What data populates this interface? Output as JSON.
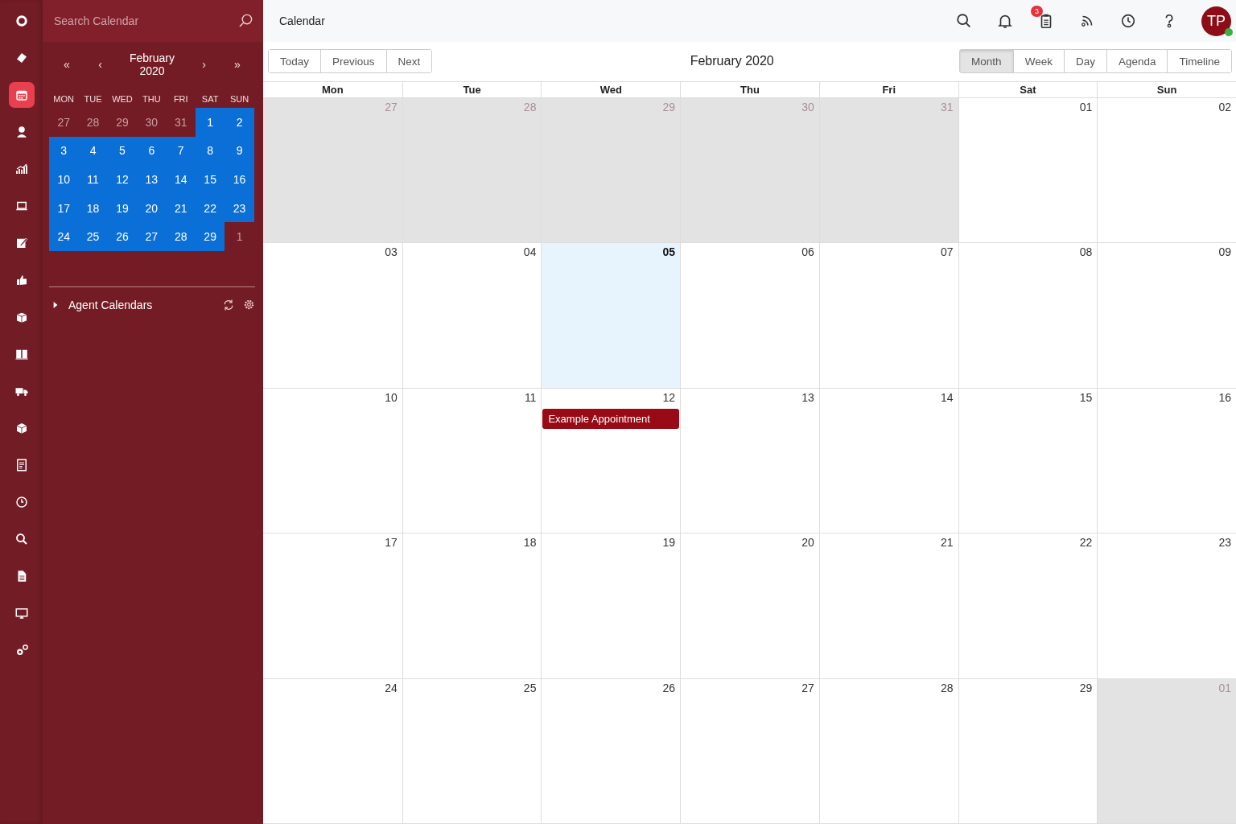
{
  "rail": [
    {
      "selected": false
    },
    {
      "selected": false
    },
    {
      "selected": true
    },
    {
      "selected": false
    },
    {
      "selected": false
    },
    {
      "selected": false
    },
    {
      "selected": false
    },
    {
      "selected": false
    },
    {
      "selected": false
    },
    {
      "selected": false
    },
    {
      "selected": false
    },
    {
      "selected": false
    },
    {
      "selected": false
    },
    {
      "selected": false
    },
    {
      "selected": false
    },
    {
      "selected": false
    },
    {
      "selected": false
    },
    {
      "selected": false
    }
  ],
  "search": {
    "placeholder": "Search Calendar"
  },
  "mini_calendar": {
    "title": "February 2020",
    "nav": [
      "«",
      "‹",
      "›",
      "»"
    ],
    "weekdays": [
      "MON",
      "TUE",
      "WED",
      "THU",
      "FRI",
      "SAT",
      "SUN"
    ],
    "days": [
      {
        "label": "27",
        "outside": true,
        "selected": false
      },
      {
        "label": "28",
        "outside": true,
        "selected": false
      },
      {
        "label": "29",
        "outside": true,
        "selected": false
      },
      {
        "label": "30",
        "outside": true,
        "selected": false
      },
      {
        "label": "31",
        "outside": true,
        "selected": false
      },
      {
        "label": "1",
        "outside": false,
        "selected": true
      },
      {
        "label": "2",
        "outside": false,
        "selected": true
      },
      {
        "label": "3",
        "outside": false,
        "selected": true
      },
      {
        "label": "4",
        "outside": false,
        "selected": true
      },
      {
        "label": "5",
        "outside": false,
        "selected": true
      },
      {
        "label": "6",
        "outside": false,
        "selected": true
      },
      {
        "label": "7",
        "outside": false,
        "selected": true
      },
      {
        "label": "8",
        "outside": false,
        "selected": true
      },
      {
        "label": "9",
        "outside": false,
        "selected": true
      },
      {
        "label": "10",
        "outside": false,
        "selected": true
      },
      {
        "label": "11",
        "outside": false,
        "selected": true
      },
      {
        "label": "12",
        "outside": false,
        "selected": true
      },
      {
        "label": "13",
        "outside": false,
        "selected": true
      },
      {
        "label": "14",
        "outside": false,
        "selected": true
      },
      {
        "label": "15",
        "outside": false,
        "selected": true
      },
      {
        "label": "16",
        "outside": false,
        "selected": true
      },
      {
        "label": "17",
        "outside": false,
        "selected": true
      },
      {
        "label": "18",
        "outside": false,
        "selected": true
      },
      {
        "label": "19",
        "outside": false,
        "selected": true
      },
      {
        "label": "20",
        "outside": false,
        "selected": true
      },
      {
        "label": "21",
        "outside": false,
        "selected": true
      },
      {
        "label": "22",
        "outside": false,
        "selected": true
      },
      {
        "label": "23",
        "outside": false,
        "selected": true
      },
      {
        "label": "24",
        "outside": false,
        "selected": true
      },
      {
        "label": "25",
        "outside": false,
        "selected": true
      },
      {
        "label": "26",
        "outside": false,
        "selected": true
      },
      {
        "label": "27",
        "outside": false,
        "selected": true
      },
      {
        "label": "28",
        "outside": false,
        "selected": true
      },
      {
        "label": "29",
        "outside": false,
        "selected": true
      },
      {
        "label": "1",
        "outside": true,
        "selected": false
      }
    ]
  },
  "agent_calendars": {
    "label": "Agent Calendars",
    "expanded": false
  },
  "header": {
    "title": "Calendar",
    "notification_badge": "3",
    "avatar_initials": "TP",
    "online": true
  },
  "toolbar": {
    "nav_buttons": [
      "Today",
      "Previous",
      "Next"
    ],
    "title": "February 2020",
    "views": [
      {
        "label": "Month",
        "selected": true
      },
      {
        "label": "Week",
        "selected": false
      },
      {
        "label": "Day",
        "selected": false
      },
      {
        "label": "Agenda",
        "selected": false
      },
      {
        "label": "Timeline",
        "selected": false
      }
    ]
  },
  "month": {
    "weekdays": [
      "Mon",
      "Tue",
      "Wed",
      "Thu",
      "Fri",
      "Sat",
      "Sun"
    ],
    "weeks": [
      [
        {
          "label": "27",
          "outside": true,
          "today": false
        },
        {
          "label": "28",
          "outside": true,
          "today": false
        },
        {
          "label": "29",
          "outside": true,
          "today": false
        },
        {
          "label": "30",
          "outside": true,
          "today": false
        },
        {
          "label": "31",
          "outside": true,
          "today": false
        },
        {
          "label": "01",
          "outside": false,
          "today": false
        },
        {
          "label": "02",
          "outside": false,
          "today": false
        }
      ],
      [
        {
          "label": "03",
          "outside": false,
          "today": false
        },
        {
          "label": "04",
          "outside": false,
          "today": false
        },
        {
          "label": "05",
          "outside": false,
          "today": true
        },
        {
          "label": "06",
          "outside": false,
          "today": false
        },
        {
          "label": "07",
          "outside": false,
          "today": false
        },
        {
          "label": "08",
          "outside": false,
          "today": false
        },
        {
          "label": "09",
          "outside": false,
          "today": false
        }
      ],
      [
        {
          "label": "10",
          "outside": false,
          "today": false
        },
        {
          "label": "11",
          "outside": false,
          "today": false
        },
        {
          "label": "12",
          "outside": false,
          "today": false,
          "events": [
            "Example Appointment"
          ]
        },
        {
          "label": "13",
          "outside": false,
          "today": false
        },
        {
          "label": "14",
          "outside": false,
          "today": false
        },
        {
          "label": "15",
          "outside": false,
          "today": false
        },
        {
          "label": "16",
          "outside": false,
          "today": false
        }
      ],
      [
        {
          "label": "17",
          "outside": false,
          "today": false
        },
        {
          "label": "18",
          "outside": false,
          "today": false
        },
        {
          "label": "19",
          "outside": false,
          "today": false
        },
        {
          "label": "20",
          "outside": false,
          "today": false
        },
        {
          "label": "21",
          "outside": false,
          "today": false
        },
        {
          "label": "22",
          "outside": false,
          "today": false
        },
        {
          "label": "23",
          "outside": false,
          "today": false
        }
      ],
      [
        {
          "label": "24",
          "outside": false,
          "today": false
        },
        {
          "label": "25",
          "outside": false,
          "today": false
        },
        {
          "label": "26",
          "outside": false,
          "today": false
        },
        {
          "label": "27",
          "outside": false,
          "today": false
        },
        {
          "label": "28",
          "outside": false,
          "today": false
        },
        {
          "label": "29",
          "outside": false,
          "today": false
        },
        {
          "label": "01",
          "outside": true,
          "today": false
        }
      ]
    ]
  }
}
